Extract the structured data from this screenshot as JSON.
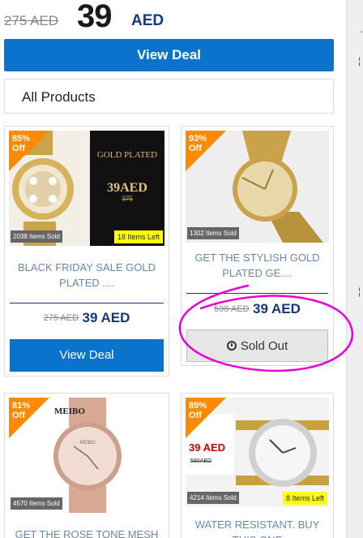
{
  "top": {
    "old_price": "275 AED",
    "big_price": "39",
    "currency": "AED",
    "view_deal": "View Deal"
  },
  "section": {
    "title": "All Products"
  },
  "products": [
    {
      "discount": "85%",
      "off": "Off",
      "sold": "2038 Items Sold",
      "left": "18 Items Left",
      "title": "BLACK FRIDAY SALE GOLD PLATED ....",
      "old_price": "275 AED",
      "price": "39 AED",
      "button": "View Deal",
      "banner_brand": "GOLD PLATED",
      "banner_price": "39AED",
      "banner_old": "375"
    },
    {
      "discount": "93%",
      "off": "Off",
      "sold": "1302 Items Sold",
      "title": "GET THE STYLISH GOLD PLATED GE....",
      "old_price": "598 AED",
      "price": "39 AED",
      "button": "Sold Out"
    },
    {
      "discount": "81%",
      "off": "Off",
      "sold": "4570 Items Sold",
      "title": "GET THE ROSE TONE MESH",
      "brand": "MEIBO"
    },
    {
      "discount": "89%",
      "off": "Off",
      "sold": "4214 Items Sold",
      "left": "8 Items Left",
      "title": "WATER RESISTANT. BUY THIS ONE",
      "banner_price": "39 AED",
      "banner_old": "590AED"
    }
  ],
  "colors": {
    "accent": "#0a73cc",
    "price": "#16397a",
    "badge": "#ff8a00",
    "annotation": "#e800d8"
  }
}
